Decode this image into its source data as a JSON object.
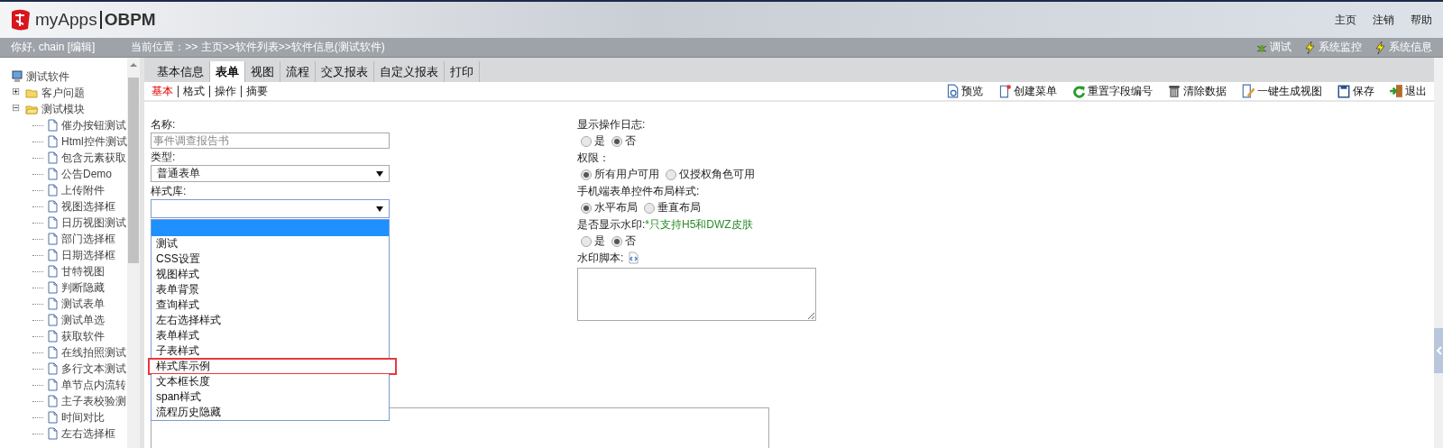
{
  "header": {
    "logo_text": "myApps",
    "product": "OBPM",
    "nav": [
      "主页",
      "注销",
      "帮助"
    ]
  },
  "info_bar": {
    "greeting": "你好, chain [编辑]",
    "breadcrumb": "当前位置：>> 主页>>软件列表>>软件信息(测试软件)",
    "tools": [
      {
        "kind": "bug",
        "label": "调试"
      },
      {
        "kind": "bolt",
        "label": "系统监控"
      },
      {
        "kind": "bolt",
        "label": "系统信息"
      }
    ]
  },
  "tree": {
    "label": "测试软件",
    "children": [
      {
        "label": "客户问题",
        "expanded": false
      },
      {
        "label": "测试模块",
        "expanded": true,
        "children": [
          {
            "label": "催办按钮测试"
          },
          {
            "label": "Html控件测试"
          },
          {
            "label": "包含元素获取"
          },
          {
            "label": "公告Demo"
          },
          {
            "label": "上传附件"
          },
          {
            "label": "视图选择框"
          },
          {
            "label": "日历视图测试"
          },
          {
            "label": "部门选择框"
          },
          {
            "label": "日期选择框"
          },
          {
            "label": "甘特视图"
          },
          {
            "label": "判断隐藏"
          },
          {
            "label": "测试表单"
          },
          {
            "label": "测试单选"
          },
          {
            "label": "获取软件"
          },
          {
            "label": "在线拍照测试"
          },
          {
            "label": "多行文本测试"
          },
          {
            "label": "单节点内流转"
          },
          {
            "label": "主子表校验测"
          },
          {
            "label": "时间对比"
          },
          {
            "label": "左右选择框"
          }
        ]
      }
    ]
  },
  "tabs": [
    {
      "label": "基本信息",
      "selected": false
    },
    {
      "label": "表单",
      "selected": true
    },
    {
      "label": "视图",
      "selected": false
    },
    {
      "label": "流程",
      "selected": false
    },
    {
      "label": "交叉报表",
      "selected": false
    },
    {
      "label": "自定义报表",
      "selected": false
    },
    {
      "label": "打印",
      "selected": false
    }
  ],
  "subtabs": [
    {
      "label": "基本",
      "selected": true
    },
    {
      "label": "格式",
      "selected": false
    },
    {
      "label": "操作",
      "selected": false
    },
    {
      "label": "摘要",
      "selected": false
    }
  ],
  "toolbar": [
    {
      "kind": "preview",
      "label": "预览"
    },
    {
      "kind": "menu",
      "label": "创建菜单"
    },
    {
      "kind": "reset",
      "label": "重置字段编号"
    },
    {
      "kind": "trash",
      "label": "清除数据"
    },
    {
      "kind": "edit",
      "label": "一键生成视图"
    },
    {
      "kind": "save",
      "label": "保存"
    },
    {
      "kind": "exit",
      "label": "退出"
    }
  ],
  "form_left": {
    "name_label": "名称:",
    "name_placeholder": "事件调查报告书",
    "type_label": "类型:",
    "type_value": "普通表单",
    "style_label": "样式库:",
    "style_dropdown": {
      "blank_selected": true,
      "options": [
        {
          "label": "测试",
          "selected": false,
          "highlighted": false
        },
        {
          "label": "CSS设置",
          "selected": false,
          "highlighted": false
        },
        {
          "label": "视图样式",
          "selected": false,
          "highlighted": false
        },
        {
          "label": "表单背景",
          "selected": false,
          "highlighted": false
        },
        {
          "label": "查询样式",
          "selected": false,
          "highlighted": false
        },
        {
          "label": "左右选择样式",
          "selected": false,
          "highlighted": false
        },
        {
          "label": "表单样式",
          "selected": false,
          "highlighted": false
        },
        {
          "label": "子表样式",
          "selected": false,
          "highlighted": false
        },
        {
          "label": "样式库示例",
          "selected": false,
          "highlighted": true
        },
        {
          "label": "文本框长度",
          "selected": false,
          "highlighted": false
        },
        {
          "label": "span样式",
          "selected": false,
          "highlighted": false
        },
        {
          "label": "流程历史隐藏",
          "selected": false,
          "highlighted": false
        }
      ]
    }
  },
  "form_right": [
    {
      "kind": "radio",
      "label": "显示操作日志:",
      "options": [
        {
          "label": "是",
          "selected": false
        },
        {
          "label": "否",
          "selected": true
        }
      ]
    },
    {
      "kind": "radio",
      "label": "权限：",
      "options": [
        {
          "label": "所有用户可用",
          "selected": true
        },
        {
          "label": "仅授权角色可用",
          "selected": false
        }
      ]
    },
    {
      "kind": "radio",
      "label": "手机端表单控件布局样式:",
      "options": [
        {
          "label": "水平布局",
          "selected": true
        },
        {
          "label": "垂直布局",
          "selected": false
        }
      ]
    },
    {
      "kind": "radio",
      "label": "是否显示水印:",
      "note": "*只支持H5和DWZ皮肤",
      "options": [
        {
          "label": "是",
          "selected": false
        },
        {
          "label": "否",
          "selected": true
        }
      ]
    },
    {
      "kind": "script",
      "label": "水印脚本:"
    }
  ]
}
